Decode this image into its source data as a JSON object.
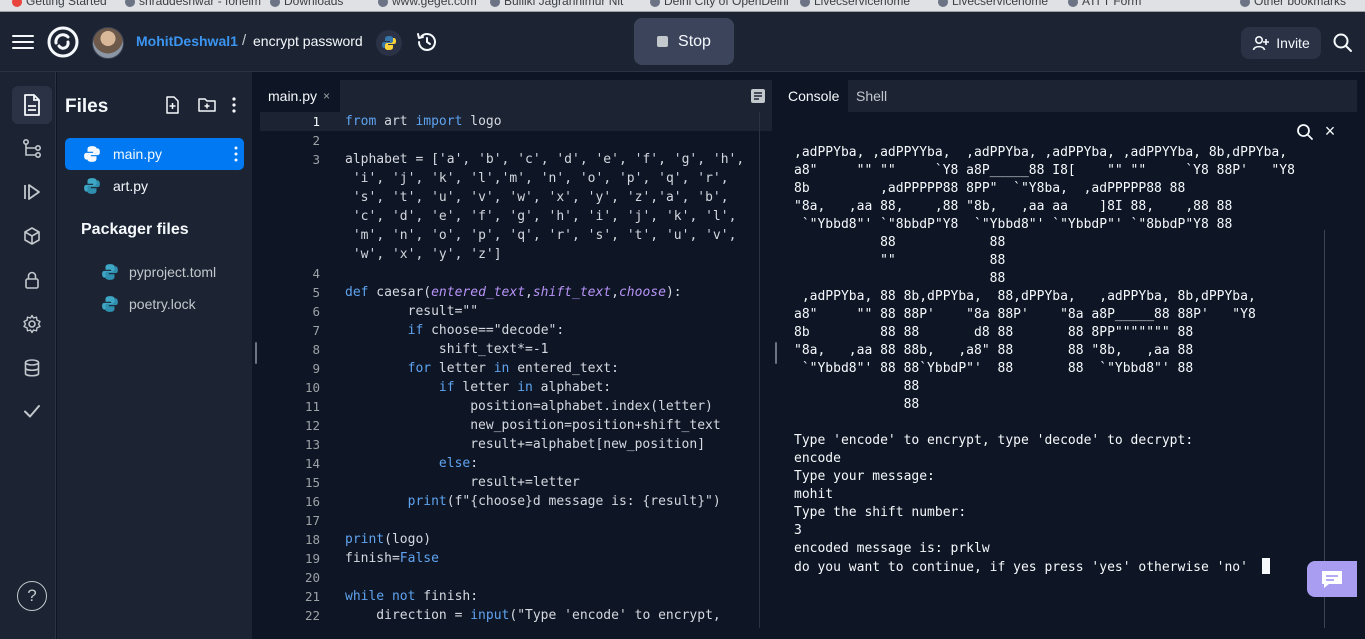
{
  "bookmarks": [
    "Getting Started",
    "shraddeshwar - fohelm",
    "Downloads",
    "www.geget.com",
    "Bulliki Jagranhimur Nit",
    "Delhi City of OpenDelhi",
    "Livecservicehome",
    "Livecservicehome",
    "ATI T Form",
    "Other bookmarks"
  ],
  "topbar": {
    "user": "MohitDeshwal1",
    "separator": "/",
    "repl_name": "encrypt password",
    "stop_label": "Stop",
    "invite_label": "Invite"
  },
  "files": {
    "title": "Files",
    "items": [
      {
        "name": "main.py",
        "active": true
      },
      {
        "name": "art.py",
        "active": false
      }
    ],
    "packager_title": "Packager files",
    "packager_items": [
      "pyproject.toml",
      "poetry.lock"
    ]
  },
  "editor": {
    "tab_label": "main.py",
    "tab_close": "×",
    "lines": [
      {
        "n": "1",
        "code": "from art import logo"
      },
      {
        "n": "2",
        "code": ""
      },
      {
        "n": "3",
        "code": "alphabet = ['a', 'b', 'c', 'd', 'e', 'f', 'g', 'h',"
      },
      {
        "n": "",
        "code": " 'i', 'j', 'k', 'l','m', 'n', 'o', 'p', 'q', 'r',"
      },
      {
        "n": "",
        "code": " 's', 't', 'u', 'v', 'w', 'x', 'y', 'z','a', 'b',"
      },
      {
        "n": "",
        "code": " 'c', 'd', 'e', 'f', 'g', 'h', 'i', 'j', 'k', 'l',"
      },
      {
        "n": "",
        "code": " 'm', 'n', 'o', 'p', 'q', 'r', 's', 't', 'u', 'v',"
      },
      {
        "n": "",
        "code": " 'w', 'x', 'y', 'z']"
      },
      {
        "n": "4",
        "code": ""
      },
      {
        "n": "5",
        "code": "def caesar(entered_text,shift_text,choose):"
      },
      {
        "n": "6",
        "code": "        result=\"\""
      },
      {
        "n": "7",
        "code": "        if choose==\"decode\":"
      },
      {
        "n": "8",
        "code": "            shift_text*=-1"
      },
      {
        "n": "9",
        "code": "        for letter in entered_text:"
      },
      {
        "n": "10",
        "code": "            if letter in alphabet:"
      },
      {
        "n": "11",
        "code": "                position=alphabet.index(letter)"
      },
      {
        "n": "12",
        "code": "                new_position=position+shift_text"
      },
      {
        "n": "13",
        "code": "                result+=alphabet[new_position]"
      },
      {
        "n": "14",
        "code": "            else:"
      },
      {
        "n": "15",
        "code": "                result+=letter"
      },
      {
        "n": "16",
        "code": "        print(f\"{choose}d message is: {result}\")"
      },
      {
        "n": "17",
        "code": ""
      },
      {
        "n": "18",
        "code": "print(logo)"
      },
      {
        "n": "19",
        "code": "finish=False"
      },
      {
        "n": "20",
        "code": ""
      },
      {
        "n": "21",
        "code": "while not finish:"
      },
      {
        "n": "22",
        "code": "    direction = input(\"Type 'encode' to encrypt,"
      }
    ]
  },
  "console": {
    "tabs": [
      "Console",
      "Shell"
    ],
    "close": "×",
    "logo_lines": [
      ",adPPYba, ,adPPYYba,  ,adPPYba, ,adPPYba, ,adPPYYba, 8b,dPPYba,",
      "a8\"     \"\" \"\"     `Y8 a8P_____88 I8[    \"\" \"\"     `Y8 88P'   \"Y8",
      "8b         ,adPPPPP88 8PP\"  `\"Y8ba,  ,adPPPPP88 88",
      "\"8a,   ,aa 88,    ,88 \"8b,   ,aa aa    ]8I 88,    ,88 88",
      " `\"Ybbd8\"' `\"8bbdP\"Y8  `\"Ybbd8\"' `\"YbbdP\"' `\"8bbdP\"Y8 88",
      "           88            88",
      "           \"\"            88",
      "                         88",
      " ,adPPYba, 88 8b,dPPYba,  88,dPPYba,   ,adPPYba, 8b,dPPYba,",
      "a8\"     \"\" 88 88P'    \"8a 88P'    \"8a a8P_____88 88P'   \"Y8",
      "8b         88 88       d8 88       88 8PP\"\"\"\"\"\"\" 88",
      "\"8a,   ,aa 88 88b,   ,a8\" 88       88 \"8b,   ,aa 88",
      " `\"Ybbd8\"' 88 88`YbbdP\"'  88       88  `\"Ybbd8\"' 88",
      "              88",
      "              88"
    ],
    "output_lines": [
      "",
      "Type 'encode' to encrypt, type 'decode' to decrypt:",
      "encode",
      "Type your message:",
      "mohit",
      "Type the shift number:",
      "3",
      "encoded message is: prklw",
      "do you want to continue, if yes press 'yes' otherwise 'no' "
    ]
  }
}
